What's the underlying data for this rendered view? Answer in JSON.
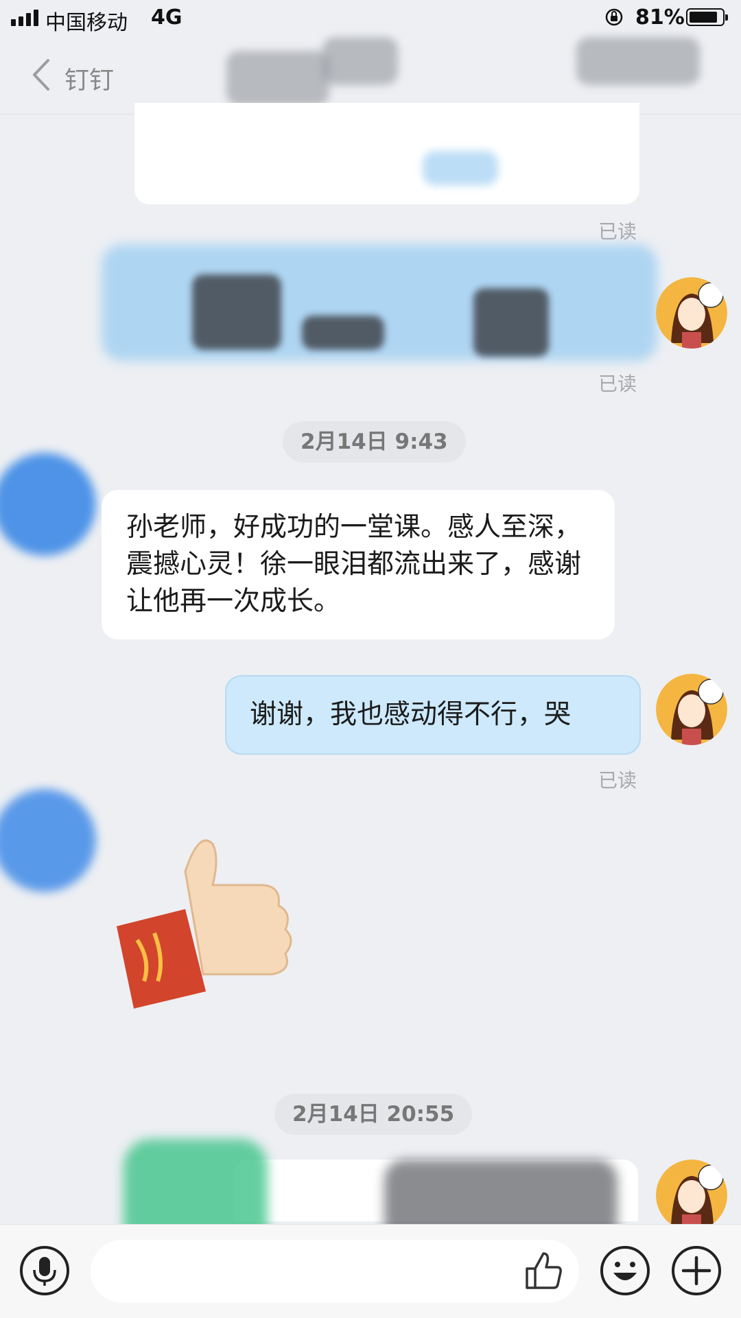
{
  "status_bar": {
    "carrier": "中国移动",
    "network": "4G",
    "battery_percent": "81%",
    "battery_level": 0.81
  },
  "nav": {
    "title_partial": "钉钉",
    "back_icon": "chevron-left-icon"
  },
  "messages": {
    "read_label_1": "已读",
    "read_label_2": "已读",
    "time_1": "2月14日 9:43",
    "incoming_text": "孙老师，好成功的一堂课。感人至深，震撼心灵！徐一眼泪都流出来了，感谢让他再一次成长。",
    "outgoing_text": "谢谢，我也感动得不行，哭",
    "read_label_3": "已读",
    "sticker": "thumbs-up-sticker",
    "time_2": "2月14日 20:55"
  },
  "input_bar": {
    "voice_icon": "microphone-icon",
    "like_icon": "thumbs-up-icon",
    "emoji_icon": "smiley-icon",
    "add_icon": "plus-icon"
  },
  "colors": {
    "background": "#edeff3",
    "outgoing_bubble": "#cde9fb",
    "incoming_bubble": "#ffffff",
    "read_text": "#a7a9ad"
  }
}
